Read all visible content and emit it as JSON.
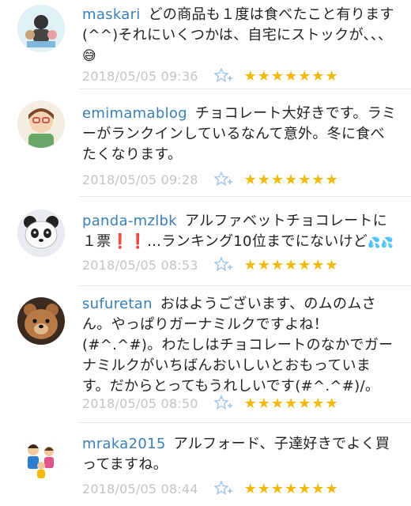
{
  "comments": [
    {
      "username": "maskari",
      "text": "どの商品も１度は食べたこと有ります(^^)それにいくつかは、自宅にストックが、、、",
      "emoji": "😅",
      "timestamp": "2018/05/05 09:36",
      "stars": "★★★★★★★",
      "avatar_icon": "user-avatar-icon"
    },
    {
      "username": "emimamablog",
      "text": "チョコレート大好きです。ラミーがランクインしているなんて意外。冬に食べたくなります。",
      "timestamp": "2018/05/05 09:28",
      "stars": "★★★★★★★",
      "avatar_icon": "user-avatar-icon"
    },
    {
      "username": "panda-mzlbk",
      "text_a": "アルファベットチョコレートに１票",
      "text_b": "…ランキング10位までにないけど",
      "emoji_exclaim": "❗❗",
      "emoji_drops": "💦💦",
      "timestamp": "2018/05/05 08:53",
      "stars": "★★★★★★★",
      "avatar_icon": "panda-avatar-icon"
    },
    {
      "username": "sufuretan",
      "text": "おはようございます、のムのムさん。やっぱりガーナミルクですよね！(#^.^#)。わたしはチョコレートのなかでガーナミルクがいちばんおいしいとおもっています。だからとってもうれしいです(#^.^#)/。",
      "timestamp": "2018/05/05 08:50",
      "stars": "★★★★★★★",
      "avatar_icon": "teddy-bear-avatar-icon"
    },
    {
      "username": "mraka2015",
      "text": "アルフォード、子達好きでよく買ってますね。",
      "timestamp": "2018/05/05 08:44",
      "stars": "★★★★★★★",
      "avatar_icon": "family-avatar-icon"
    }
  ],
  "colors": {
    "username": "#3a7fb8",
    "timestamp": "#c4c4c4",
    "star": "#f2b90a",
    "star_button": "#9ec3e6"
  }
}
